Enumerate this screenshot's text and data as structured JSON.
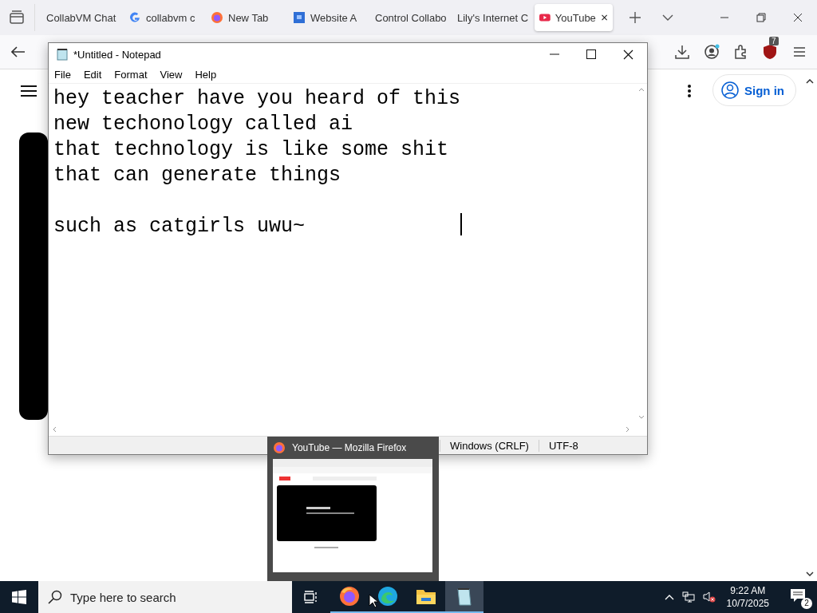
{
  "browser": {
    "tabs": [
      {
        "label": "CollabVM Chat",
        "kind": "plain",
        "selected": false
      },
      {
        "label": "collabvm c",
        "kind": "google",
        "selected": false
      },
      {
        "label": "New Tab",
        "kind": "firefox",
        "selected": false
      },
      {
        "label": "Website A",
        "kind": "site",
        "selected": false
      },
      {
        "label": "Control Collabo",
        "kind": "plain",
        "selected": false
      },
      {
        "label": "Lily's Internet C",
        "kind": "plain",
        "selected": false
      },
      {
        "label": "YouTube",
        "kind": "youtube",
        "selected": true
      }
    ],
    "extension_badge": "7",
    "sign_in": "Sign in"
  },
  "notepad": {
    "title": "*Untitled - Notepad",
    "menu": [
      "File",
      "Edit",
      "Format",
      "View",
      "Help"
    ],
    "text": "hey teacher have you heard of this\nnew techonology called ai\nthat technology is like some shit\nthat can generate things\n\nsuch as catgirls uwu~",
    "status_bar": [
      "Windows (CRLF)",
      "UTF-8"
    ]
  },
  "taskbar_preview": {
    "title": "YouTube — Mozilla Firefox"
  },
  "taskbar": {
    "search_placeholder": "Type here to search",
    "apps": [
      {
        "kind": "firefox",
        "selected": false
      },
      {
        "kind": "edge",
        "selected": false
      },
      {
        "kind": "explorer",
        "selected": false
      },
      {
        "kind": "notepad",
        "selected": true
      }
    ],
    "time": "9:22 AM",
    "date": "10/7/2025",
    "notifications": "2"
  }
}
